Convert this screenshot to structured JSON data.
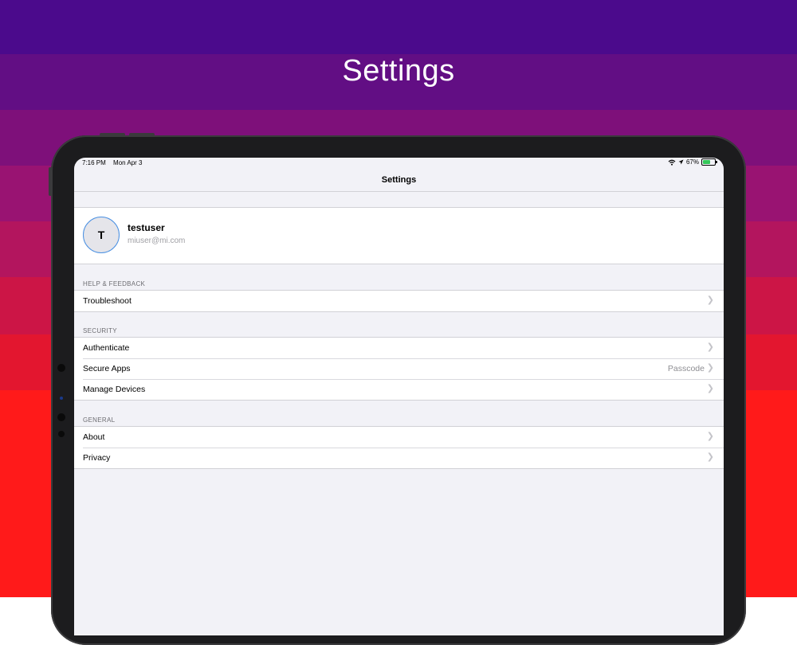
{
  "hero": {
    "title": "Settings"
  },
  "colors": {
    "bands": [
      "#4b0a8c",
      "#620e84",
      "#7e107a",
      "#991372",
      "#b3155e",
      "#cc1546",
      "#e3162f",
      "#ff1a1a"
    ],
    "accent": "#4a90e2",
    "battery": "#34c759"
  },
  "status_bar": {
    "time": "7:16 PM",
    "date": "Mon Apr 3",
    "battery_percent": "67%",
    "battery_level": 0.67,
    "icons": [
      "wifi-icon",
      "location-arrow-icon",
      "battery-charging-icon"
    ]
  },
  "nav": {
    "title": "Settings"
  },
  "profile": {
    "avatar_initial": "T",
    "username": "testuser",
    "email": "miuser@mi.com"
  },
  "sections": [
    {
      "header": "HELP & FEEDBACK",
      "rows": [
        {
          "label": "Troubleshoot",
          "detail": ""
        }
      ]
    },
    {
      "header": "SECURITY",
      "rows": [
        {
          "label": "Authenticate",
          "detail": ""
        },
        {
          "label": "Secure Apps",
          "detail": "Passcode"
        },
        {
          "label": "Manage Devices",
          "detail": ""
        }
      ]
    },
    {
      "header": "GENERAL",
      "rows": [
        {
          "label": "About",
          "detail": ""
        },
        {
          "label": "Privacy",
          "detail": ""
        }
      ]
    }
  ]
}
